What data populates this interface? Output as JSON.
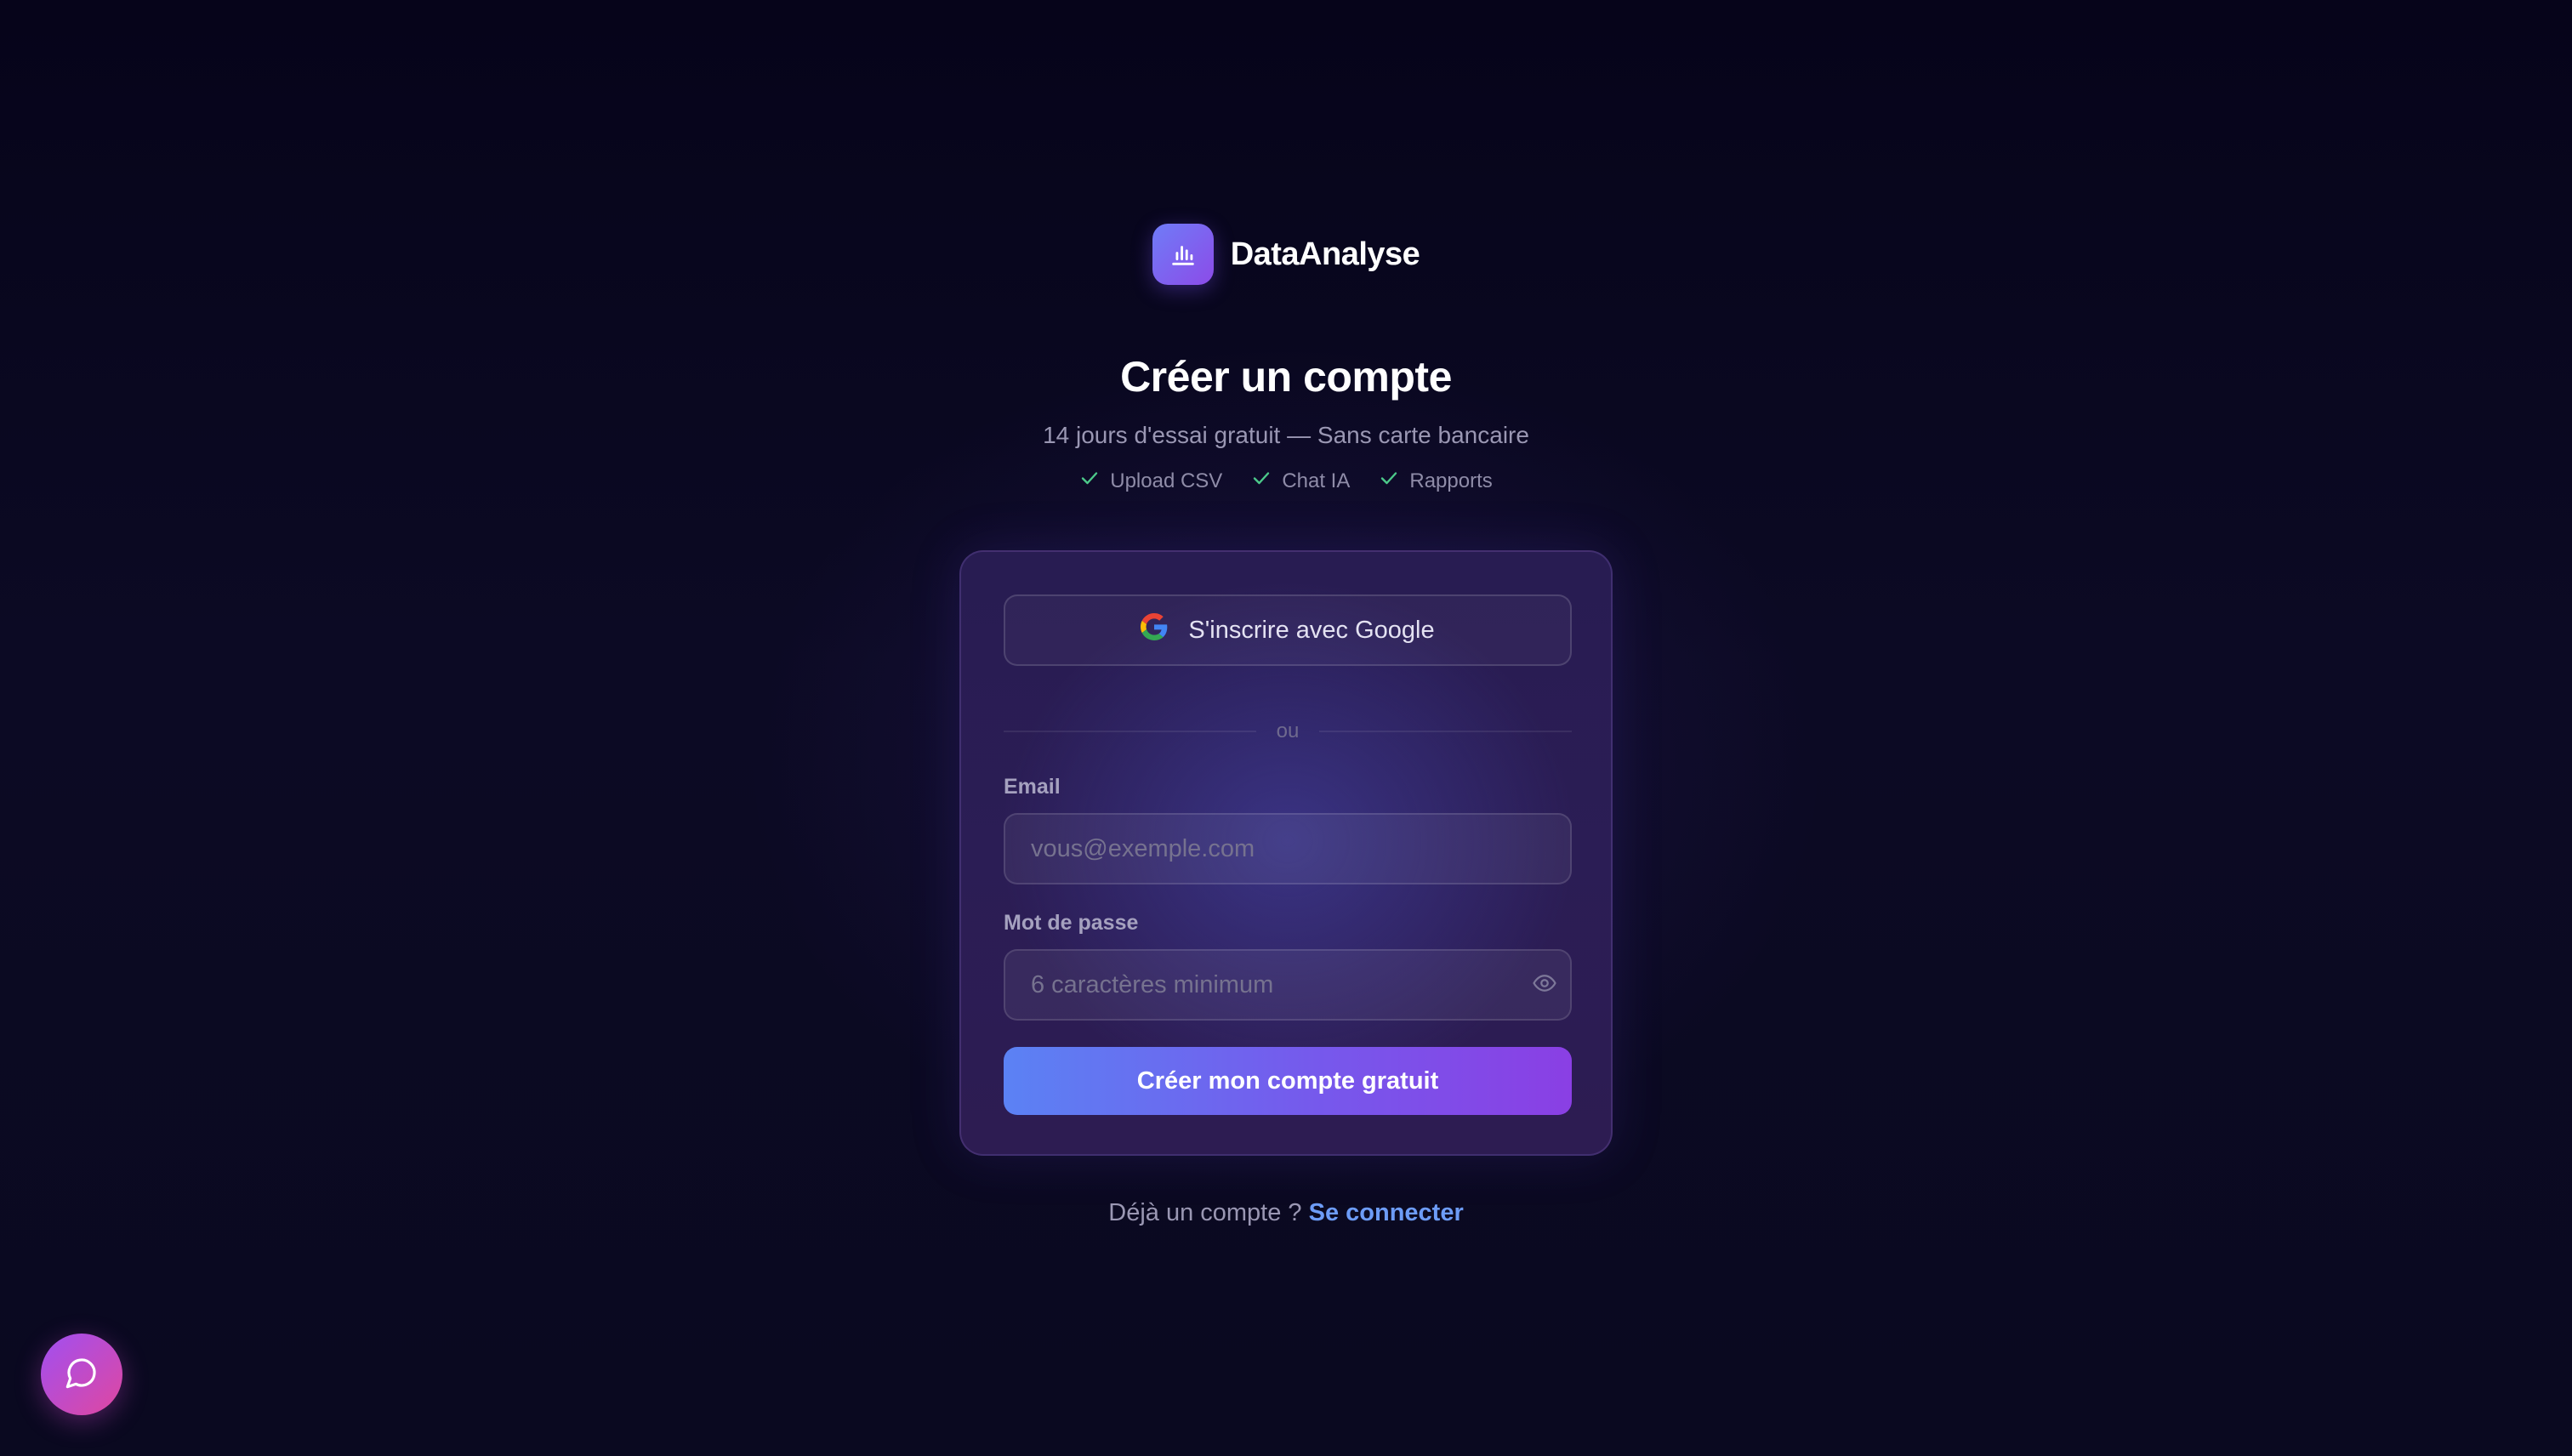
{
  "brand": {
    "name": "DataAnalyse",
    "icon": "bar-chart-icon"
  },
  "page": {
    "title": "Créer un compte",
    "subtitle": "14 jours d'essai gratuit — Sans carte bancaire",
    "features": [
      {
        "label": "Upload CSV",
        "icon": "check-icon"
      },
      {
        "label": "Chat IA",
        "icon": "check-icon"
      },
      {
        "label": "Rapports",
        "icon": "check-icon"
      }
    ]
  },
  "form": {
    "google_label": "S'inscrire avec Google",
    "divider_text": "ou",
    "email_label": "Email",
    "email_placeholder": "vous@exemple.com",
    "email_value": "",
    "password_label": "Mot de passe",
    "password_placeholder": "6 caractères minimum",
    "password_value": "",
    "submit_label": "Créer mon compte gratuit"
  },
  "footer": {
    "login_prompt": "Déjà un compte ?",
    "login_link": "Se connecter"
  },
  "chat": {
    "icon": "chat-bubble-icon"
  },
  "colors": {
    "background": "#0b0820",
    "card": "#2a1c54",
    "accent_start": "#5b82f4",
    "accent_end": "#8a3fe4",
    "link": "#6d9cf7",
    "check": "#4cc98a"
  }
}
